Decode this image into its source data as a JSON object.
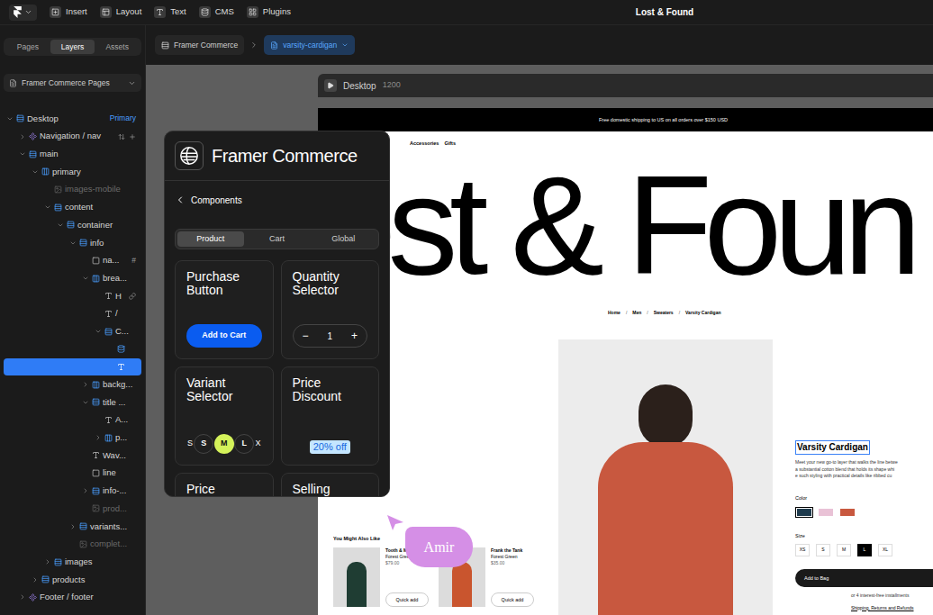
{
  "app": {
    "title": "Lost & Found"
  },
  "toolbar": [
    {
      "label": "Insert",
      "kind": "plus"
    },
    {
      "label": "Layout",
      "kind": "layout"
    },
    {
      "label": "Text",
      "kind": "text"
    },
    {
      "label": "CMS",
      "kind": "cms"
    },
    {
      "label": "Plugins",
      "kind": "plugins"
    }
  ],
  "sidebar": {
    "tabs": [
      {
        "label": "Pages",
        "selected": false
      },
      {
        "label": "Layers",
        "selected": true
      },
      {
        "label": "Assets",
        "selected": false
      }
    ],
    "page_select": "Framer Commerce Pages",
    "layers": [
      {
        "label": "Desktop",
        "depth": 0,
        "kind": "stack",
        "toggle": "open",
        "dimmed": false,
        "selected": false,
        "badge": "Primary"
      },
      {
        "label": "Navigation / nav",
        "depth": 1,
        "kind": "component",
        "toggle": "closed",
        "dimmed": false,
        "selected": false,
        "extra": "nav-actions"
      },
      {
        "label": "main",
        "depth": 1,
        "kind": "stack",
        "toggle": "open",
        "dimmed": false,
        "selected": false
      },
      {
        "label": "primary",
        "depth": 2,
        "kind": "frame",
        "toggle": "open",
        "dimmed": false,
        "selected": false
      },
      {
        "label": "images-mobile",
        "depth": 3,
        "kind": "image",
        "toggle": "none",
        "dimmed": true,
        "selected": false
      },
      {
        "label": "content",
        "depth": 3,
        "kind": "stack",
        "toggle": "open",
        "dimmed": false,
        "selected": false
      },
      {
        "label": "container",
        "depth": 4,
        "kind": "stack",
        "toggle": "open",
        "dimmed": false,
        "selected": false
      },
      {
        "label": "info",
        "depth": 5,
        "kind": "stack",
        "toggle": "open",
        "dimmed": false,
        "selected": false
      },
      {
        "label": "na...",
        "depth": 6,
        "kind": "box",
        "toggle": "none",
        "dimmed": false,
        "selected": false,
        "badge": "#"
      },
      {
        "label": "brea...",
        "depth": 6,
        "kind": "frame",
        "toggle": "open",
        "dimmed": false,
        "selected": false
      },
      {
        "label": "H",
        "depth": 7,
        "kind": "text",
        "toggle": "none",
        "dimmed": false,
        "selected": false,
        "extra": "link"
      },
      {
        "label": "/",
        "depth": 7,
        "kind": "text",
        "toggle": "none",
        "dimmed": false,
        "selected": false
      },
      {
        "label": "C...",
        "depth": 7,
        "kind": "stack",
        "toggle": "open",
        "dimmed": false,
        "selected": false
      },
      {
        "label": "",
        "depth": 8,
        "kind": "cms",
        "toggle": "none",
        "dimmed": false,
        "selected": false
      },
      {
        "label": "",
        "depth": 8,
        "kind": "text",
        "toggle": "none",
        "dimmed": false,
        "selected": true
      },
      {
        "label": "backg...",
        "depth": 6,
        "kind": "frame",
        "toggle": "closed",
        "dimmed": false,
        "selected": false
      },
      {
        "label": "title ...",
        "depth": 6,
        "kind": "stack",
        "toggle": "open",
        "dimmed": false,
        "selected": false
      },
      {
        "label": "A...",
        "depth": 7,
        "kind": "text",
        "toggle": "none",
        "dimmed": false,
        "selected": false
      },
      {
        "label": "p...",
        "depth": 7,
        "kind": "frame",
        "toggle": "closed",
        "dimmed": false,
        "selected": false
      },
      {
        "label": "Wav...",
        "depth": 6,
        "kind": "text",
        "toggle": "none",
        "dimmed": false,
        "selected": false
      },
      {
        "label": "line",
        "depth": 6,
        "kind": "box",
        "toggle": "none",
        "dimmed": false,
        "selected": false
      },
      {
        "label": "info-...",
        "depth": 6,
        "kind": "stack",
        "toggle": "closed",
        "dimmed": false,
        "selected": false
      },
      {
        "label": "prod...",
        "depth": 6,
        "kind": "image",
        "toggle": "none",
        "dimmed": true,
        "selected": false
      },
      {
        "label": "variants...",
        "depth": 5,
        "kind": "stack",
        "toggle": "closed",
        "dimmed": false,
        "selected": false
      },
      {
        "label": "complet...",
        "depth": 5,
        "kind": "image",
        "toggle": "none",
        "dimmed": true,
        "selected": false
      },
      {
        "label": "images",
        "depth": 3,
        "kind": "stack",
        "toggle": "closed",
        "dimmed": false,
        "selected": false
      },
      {
        "label": "products",
        "depth": 2,
        "kind": "stack",
        "toggle": "closed",
        "dimmed": false,
        "selected": false
      },
      {
        "label": "Footer / footer",
        "depth": 1,
        "kind": "component",
        "toggle": "closed",
        "dimmed": false,
        "selected": false
      }
    ]
  },
  "breadcrumb": [
    {
      "label": "Framer Commerce",
      "selected": false
    },
    {
      "label": "varsity-cardigan",
      "selected": true
    }
  ],
  "frame_header": {
    "label": "Desktop",
    "width": "1200"
  },
  "site": {
    "announcement": "Free domestic shipping to US on all orders over $150 USD",
    "nav": [
      "Accessories",
      "Gifts"
    ],
    "hero": "ost & Foun",
    "breadcrumbs": [
      "Home",
      "Men",
      "Sweaters",
      "Varsity Cardigan"
    ],
    "separator": "/",
    "product": {
      "title": "Varsity Cardigan",
      "description": [
        "Meet your new go-to layer that walks the line betwe",
        "a substantial cotton blend that holds its shape whi",
        "e such styling with practical details like ribbed cu"
      ],
      "color_label": "Color",
      "colors": [
        {
          "color": "#1f3b4d",
          "selected": true
        },
        {
          "color": "#e9c2d6",
          "selected": false
        },
        {
          "color": "#c8583f",
          "selected": false
        }
      ],
      "size_label": "Size",
      "sizes": [
        {
          "label": "XS",
          "selected": false
        },
        {
          "label": "S",
          "selected": false
        },
        {
          "label": "M",
          "selected": false
        },
        {
          "label": "L",
          "selected": true
        },
        {
          "label": "XL",
          "selected": false
        }
      ],
      "button": "Add to Bag",
      "installments": "or 4 interest-free installments",
      "shipping": "Shipping, Returns and Refunds"
    },
    "related": {
      "title": "You Might Also Like",
      "items": [
        {
          "name": "Tooth & M",
          "variant": "Forest Green",
          "price": "$79.00",
          "button": "Quick add"
        },
        {
          "name": "Frank the Tank",
          "variant": "Forest Green",
          "price": "$35.00",
          "button": "Quick add"
        }
      ]
    }
  },
  "commerce": {
    "title": "Framer Commerce",
    "back": "Components",
    "tabs": [
      {
        "label": "Product",
        "selected": true
      },
      {
        "label": "Cart",
        "selected": false
      },
      {
        "label": "Global",
        "selected": false
      }
    ],
    "cards": [
      {
        "title": "Purchase Button",
        "kind": "button",
        "button": "Add to Cart"
      },
      {
        "title": "Quantity Selector",
        "kind": "quantity",
        "minus": "−",
        "value": "1",
        "plus": "+"
      },
      {
        "title": "Variant Selector",
        "kind": "variant",
        "options": [
          {
            "label": "S",
            "selected": false,
            "clipped": true
          },
          {
            "label": "S",
            "selected": false,
            "clipped": false
          },
          {
            "label": "M",
            "selected": true,
            "clipped": false
          },
          {
            "label": "L",
            "selected": false,
            "clipped": false
          },
          {
            "label": "X",
            "selected": false,
            "clipped": true
          }
        ]
      },
      {
        "title": "Price Discount",
        "kind": "discount",
        "badge": "20% off"
      },
      {
        "title": "Price",
        "kind": "plain"
      },
      {
        "title": "Selling",
        "kind": "plain"
      }
    ]
  },
  "cursor": {
    "name": "Amir",
    "color": "#d58fe6"
  }
}
